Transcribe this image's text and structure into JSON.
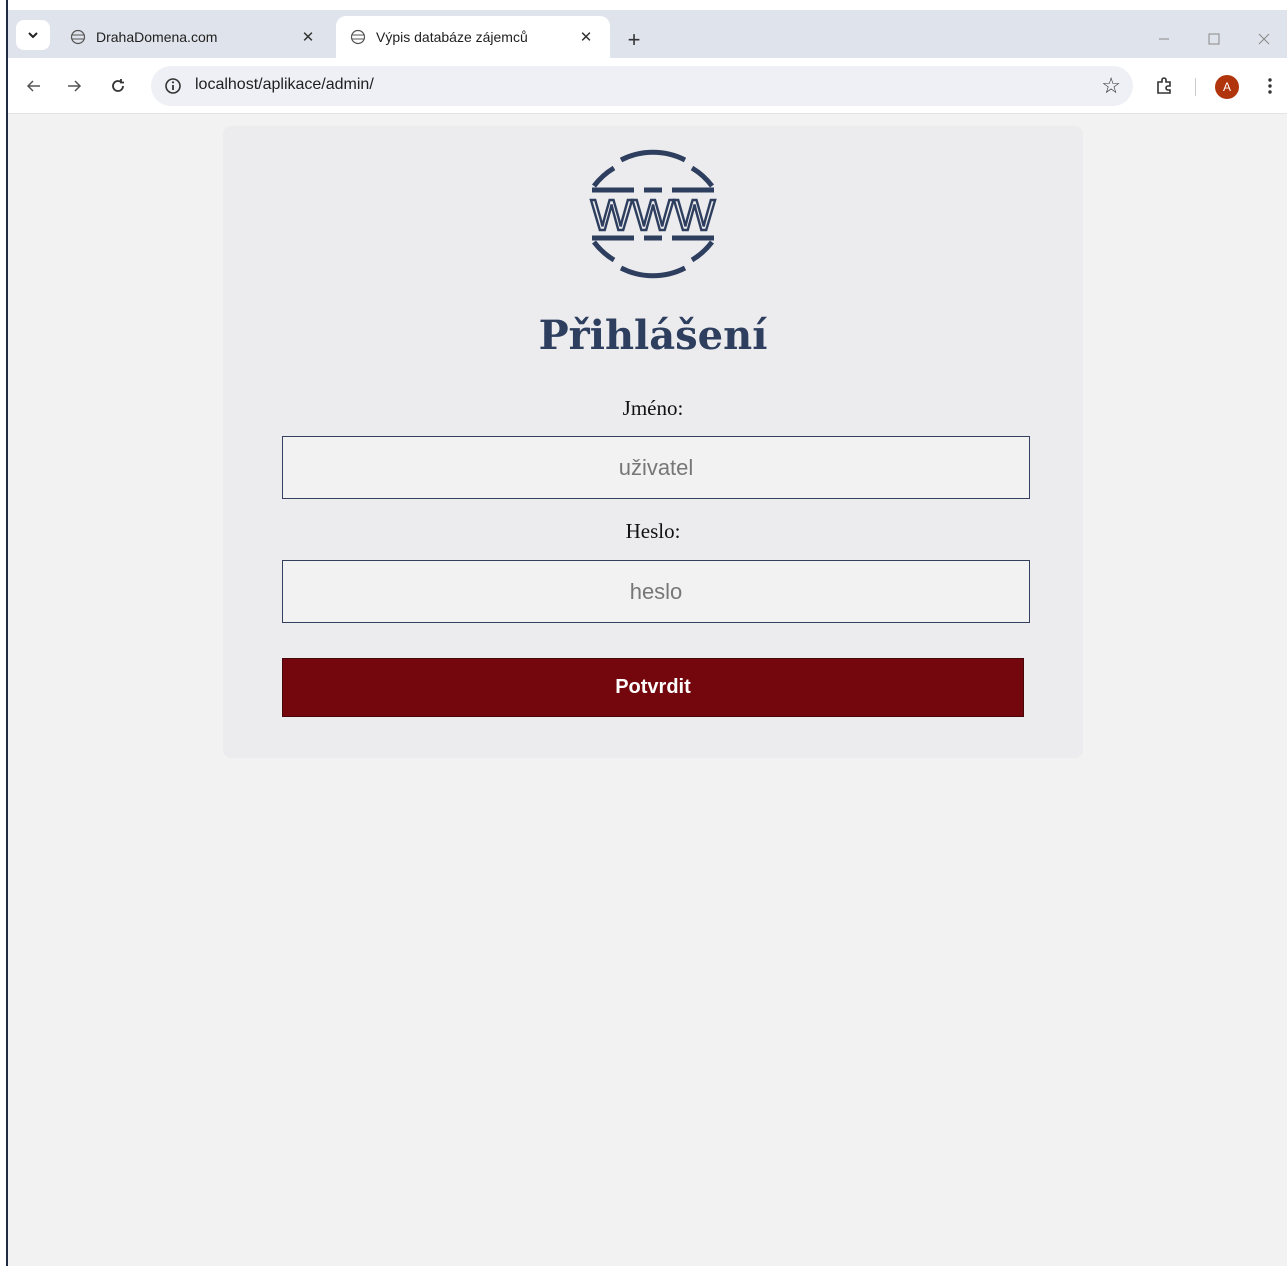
{
  "browser": {
    "tabs": [
      {
        "title": "DrahaDomena.com",
        "active": false,
        "icon": "globe-icon"
      },
      {
        "title": "Výpis databáze zájemců",
        "active": true,
        "icon": "globe-icon"
      }
    ],
    "url": "localhost/aplikace/admin/",
    "avatar_initial": "A",
    "colors": {
      "tabstrip": "#dfe3eb",
      "avatar": "#b1350c"
    }
  },
  "page": {
    "logo_text": "WWW",
    "heading": "Přihlášení",
    "username_label": "Jméno:",
    "username_placeholder": "uživatel",
    "username_value": "",
    "password_label": "Heslo:",
    "password_placeholder": "heslo",
    "password_value": "",
    "submit_label": "Potvrdit",
    "colors": {
      "heading": "#2d3e5f",
      "submit_bg": "#73070d",
      "card_bg": "#ececee",
      "page_bg": "#f2f2f2"
    }
  }
}
